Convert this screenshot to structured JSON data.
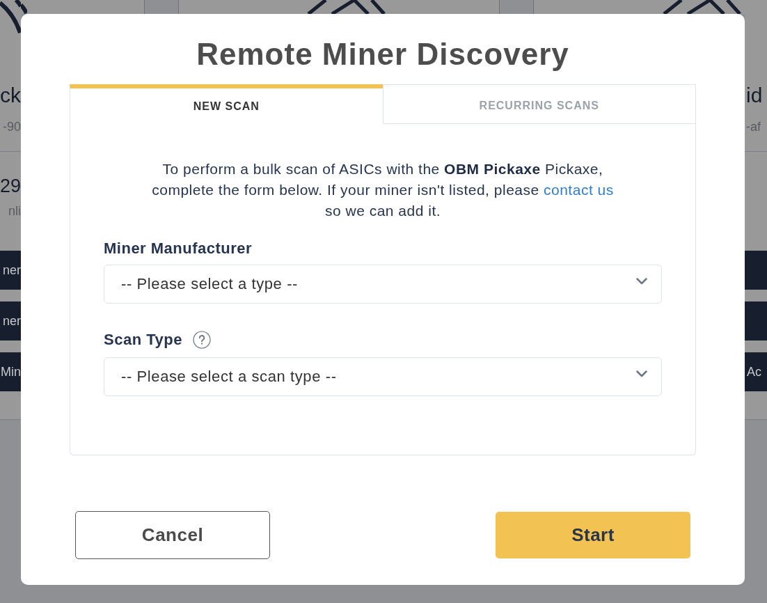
{
  "background": {
    "cards": [
      {
        "title": "ck",
        "subtitle": "-90",
        "count": "29",
        "count_label": "nli",
        "buttons": [
          {
            "kind": "text",
            "label": "ner"
          },
          {
            "kind": "text",
            "label": "ner"
          },
          {
            "kind": "text",
            "label": "Min"
          }
        ]
      },
      {
        "title": "id",
        "subtitle": "-af",
        "buttons": [
          {
            "kind": "blank"
          },
          {
            "kind": "blank"
          },
          {
            "kind": "text",
            "label": "Ac"
          }
        ]
      }
    ]
  },
  "dialog": {
    "title": "Remote Miner Discovery",
    "tabs": [
      {
        "label": "NEW SCAN",
        "selected": true
      },
      {
        "label": "RECURRING SCANS",
        "selected": false
      }
    ],
    "intro": {
      "text": "To perform a bulk scan of ASICs with the **OBM Pickaxe** Pickaxe, complete the form below. If your miner isn't listed, please",
      "link": "contact us",
      "after": "so we can add it."
    },
    "fields": [
      {
        "label": "Miner Manufacturer",
        "placeholder": "-- Please select a type --"
      },
      {
        "label": "Scan Type",
        "placeholder": "-- Please select a scan type --",
        "help": true
      }
    ],
    "buttons": [
      {
        "label": "Cancel",
        "kind": "secondary"
      },
      {
        "label": "Start",
        "kind": "primary"
      }
    ]
  }
}
